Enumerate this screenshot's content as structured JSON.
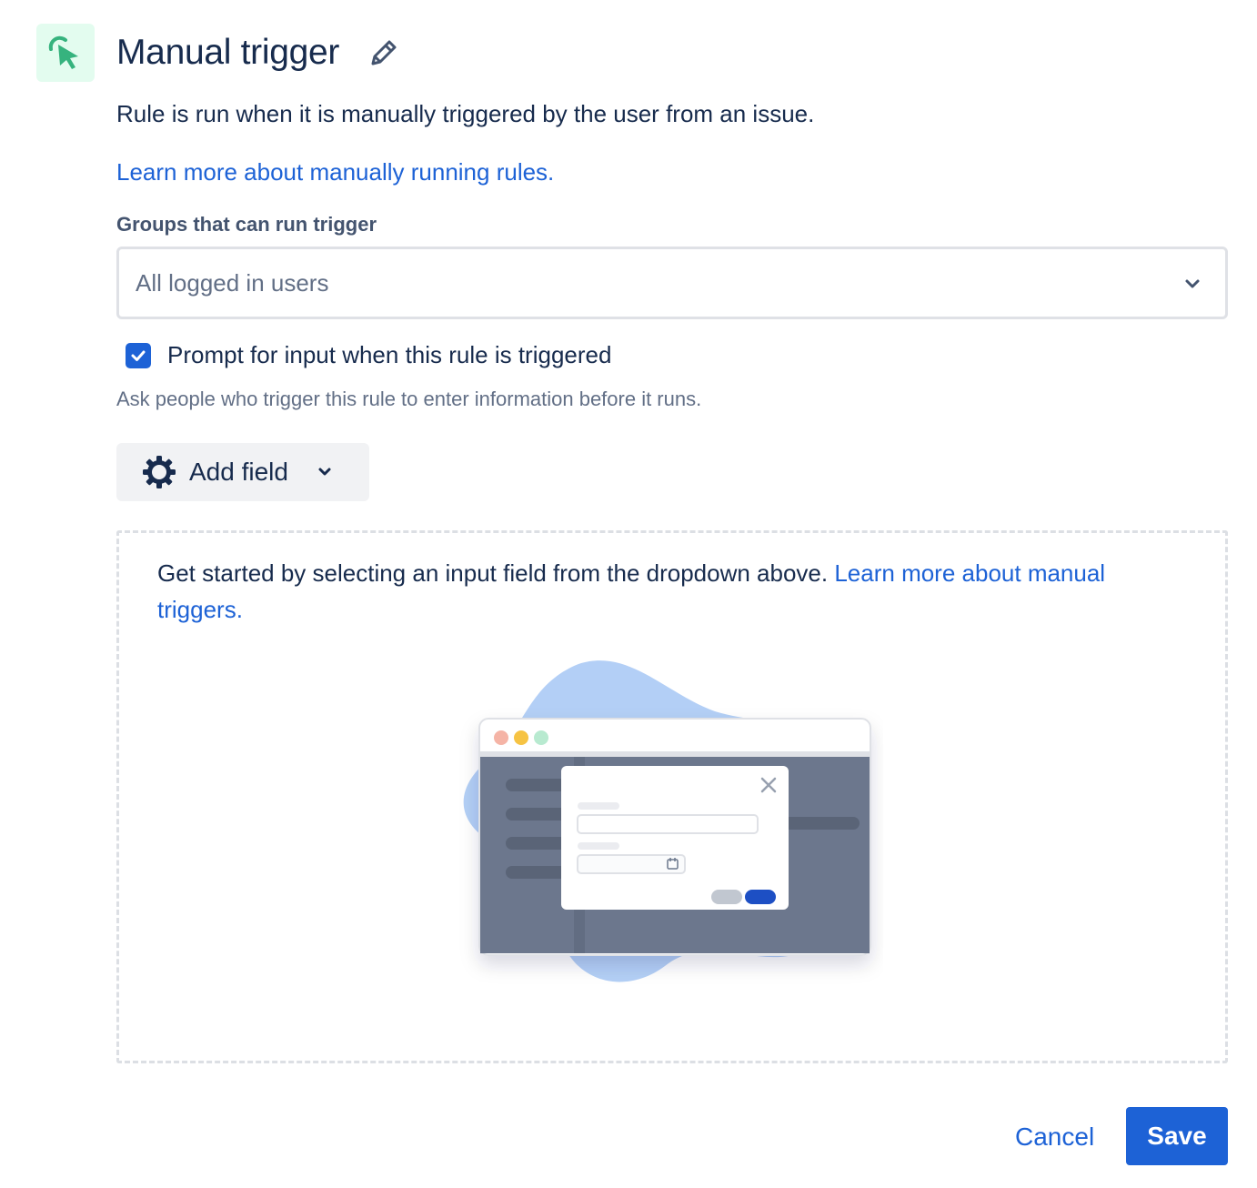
{
  "header": {
    "title": "Manual trigger",
    "icon": "cursor-click-icon",
    "edit_icon": "pencil-icon"
  },
  "description": "Rule is run when it is manually triggered by the user from an issue.",
  "learn_more_link": "Learn more about manually running rules.",
  "groups": {
    "label": "Groups that can run trigger",
    "selected": "All logged in users"
  },
  "prompt": {
    "checked": true,
    "label": "Prompt for input when this rule is triggered",
    "helper": "Ask people who trigger this rule to enter information before it runs."
  },
  "add_field": {
    "label": "Add field",
    "icon": "gear-icon"
  },
  "empty_state": {
    "text": "Get started by selecting an input field from the dropdown above.",
    "link": "Learn more about manual triggers."
  },
  "footer": {
    "cancel_label": "Cancel",
    "save_label": "Save"
  },
  "colors": {
    "accent": "#1d62d6",
    "icon_bg": "#e3fcef",
    "icon_green": "#36b37e",
    "text": "#172b4d"
  }
}
